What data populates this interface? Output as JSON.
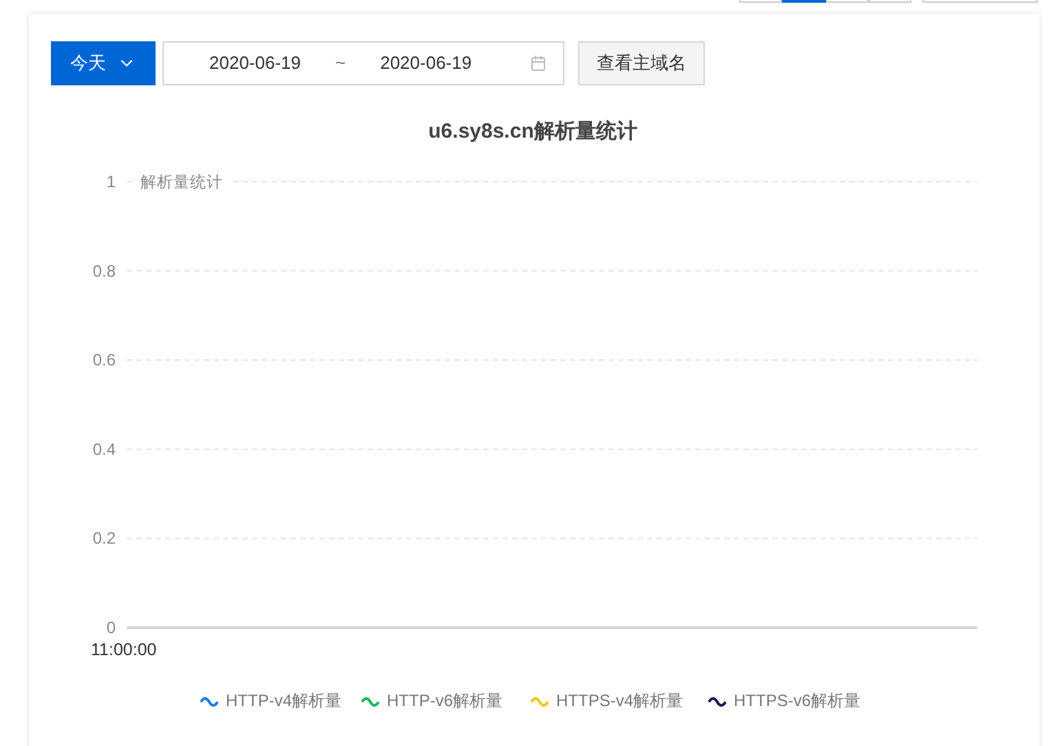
{
  "segment_tabs": [
    {
      "selected": false
    },
    {
      "selected": true
    },
    {
      "selected": false
    },
    {
      "selected": false
    }
  ],
  "toolbar": {
    "range_button": "今天",
    "date_start": "2020-06-19",
    "date_separator": "~",
    "date_end": "2020-06-19",
    "domain_button": "查看主域名"
  },
  "chart": {
    "chart_data": {
      "type": "line",
      "title": "u6.sy8s.cn解析量统计",
      "ylabel": "解析量统计",
      "categories": [
        "11:00:00"
      ],
      "ylim": [
        0,
        1
      ],
      "grid": true,
      "yticks": [
        {
          "value": 0,
          "label": "0"
        },
        {
          "value": 0.2,
          "label": "0.2"
        },
        {
          "value": 0.4,
          "label": "0.4"
        },
        {
          "value": 0.6,
          "label": "0.6"
        },
        {
          "value": 0.8,
          "label": "0.8"
        },
        {
          "value": 1,
          "label": "1"
        }
      ],
      "series": [
        {
          "name": "HTTP-v4解析量",
          "color": "#1a7ee6",
          "values": [
            null
          ]
        },
        {
          "name": "HTTP-v6解析量",
          "color": "#18b864",
          "values": [
            null
          ]
        },
        {
          "name": "HTTPS-v4解析量",
          "color": "#f2c811",
          "values": [
            null
          ]
        },
        {
          "name": "HTTPS-v6解析量",
          "color": "#1c1d5c",
          "values": [
            null
          ]
        }
      ]
    }
  }
}
